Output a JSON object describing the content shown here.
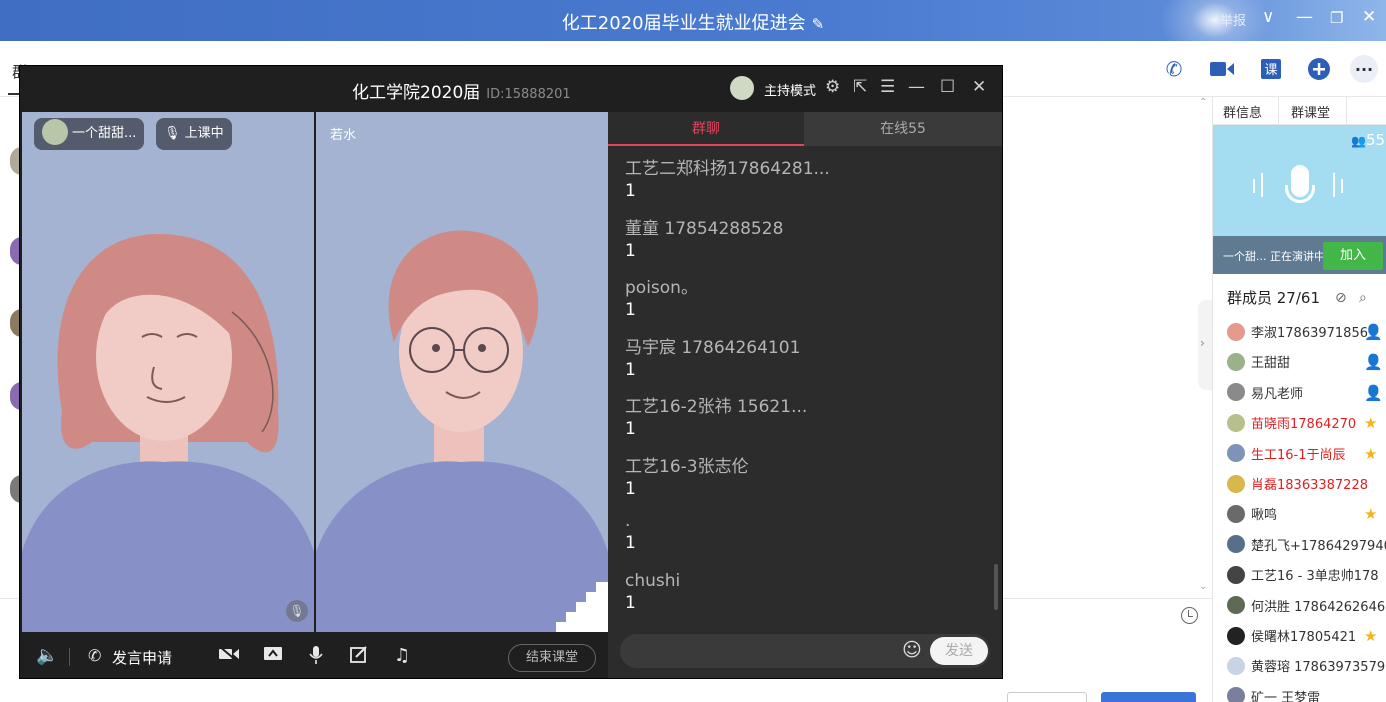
{
  "window": {
    "title": "化工2020届毕业生就业促进会",
    "report": "举报"
  },
  "group_tab": "群",
  "popup": {
    "class_name": "化工学院2020届",
    "group_id": "ID:15888201",
    "host_mode": "主持模式",
    "video1": {
      "user": "一个甜甜...",
      "status": "上课中"
    },
    "video2": {
      "user": "若水"
    },
    "controls": {
      "apply_speak": "发言申请",
      "end_class": "结束课堂"
    },
    "chat": {
      "tab_group": "群聊",
      "tab_online": "在线55",
      "send": "发送",
      "messages": [
        {
          "sender": "工艺二郑科扬17864281...",
          "text": "1"
        },
        {
          "sender": "董童 17854288528",
          "text": "1"
        },
        {
          "sender": "poison。",
          "text": "1"
        },
        {
          "sender": "马宇宸 17864264101",
          "text": "1"
        },
        {
          "sender": "工艺16-2张祎 15621...",
          "text": "1"
        },
        {
          "sender": "工艺16-3张志伦",
          "text": "1"
        },
        {
          "sender": ".",
          "text": "1"
        },
        {
          "sender": "chushi",
          "text": "1"
        }
      ]
    }
  },
  "right_panel": {
    "tab_info": "群信息",
    "tab_class": "群课堂",
    "online_count": "55",
    "speaking": "一个甜... 正在演讲中",
    "join": "加入",
    "members_header": "群成员 27/61",
    "members": [
      {
        "name": "李淑17863971856",
        "red": false,
        "badge": "person",
        "color": "#e59a8e"
      },
      {
        "name": "王甜甜",
        "red": false,
        "badge": "host",
        "color": "#9ab28a"
      },
      {
        "name": "易凡老师",
        "red": false,
        "badge": "host",
        "color": "#8a8a8a"
      },
      {
        "name": "苗晓雨17864270",
        "red": true,
        "badge": "star",
        "color": "#b7c08a"
      },
      {
        "name": "生工16-1于尚辰",
        "red": true,
        "badge": "star",
        "color": "#7d94b8"
      },
      {
        "name": "肖磊18363387228",
        "red": true,
        "badge": "",
        "color": "#d8b84a"
      },
      {
        "name": "啾鸣",
        "red": false,
        "badge": "star",
        "color": "#6a6a6a"
      },
      {
        "name": "楚孔飞+17864297940",
        "red": false,
        "badge": "",
        "color": "#56708a"
      },
      {
        "name": "工艺16 - 3单忠帅178",
        "red": false,
        "badge": "",
        "color": "#444444"
      },
      {
        "name": "何洪胜 17864262646",
        "red": false,
        "badge": "",
        "color": "#5d6b55"
      },
      {
        "name": "侯曙林17805421",
        "red": false,
        "badge": "star",
        "color": "#222222"
      },
      {
        "name": "黄蓉瑢 17863973579",
        "red": false,
        "badge": "",
        "color": "#c8d3e6"
      },
      {
        "name": "矿一 王梦雷",
        "red": false,
        "badge": "",
        "color": "#7a7f9a"
      }
    ]
  },
  "colors": {
    "accent": "#4a7bd0",
    "join_green": "#43b649",
    "chat_tab_red": "#e2445c",
    "video_bg": "#a4b3d1"
  }
}
